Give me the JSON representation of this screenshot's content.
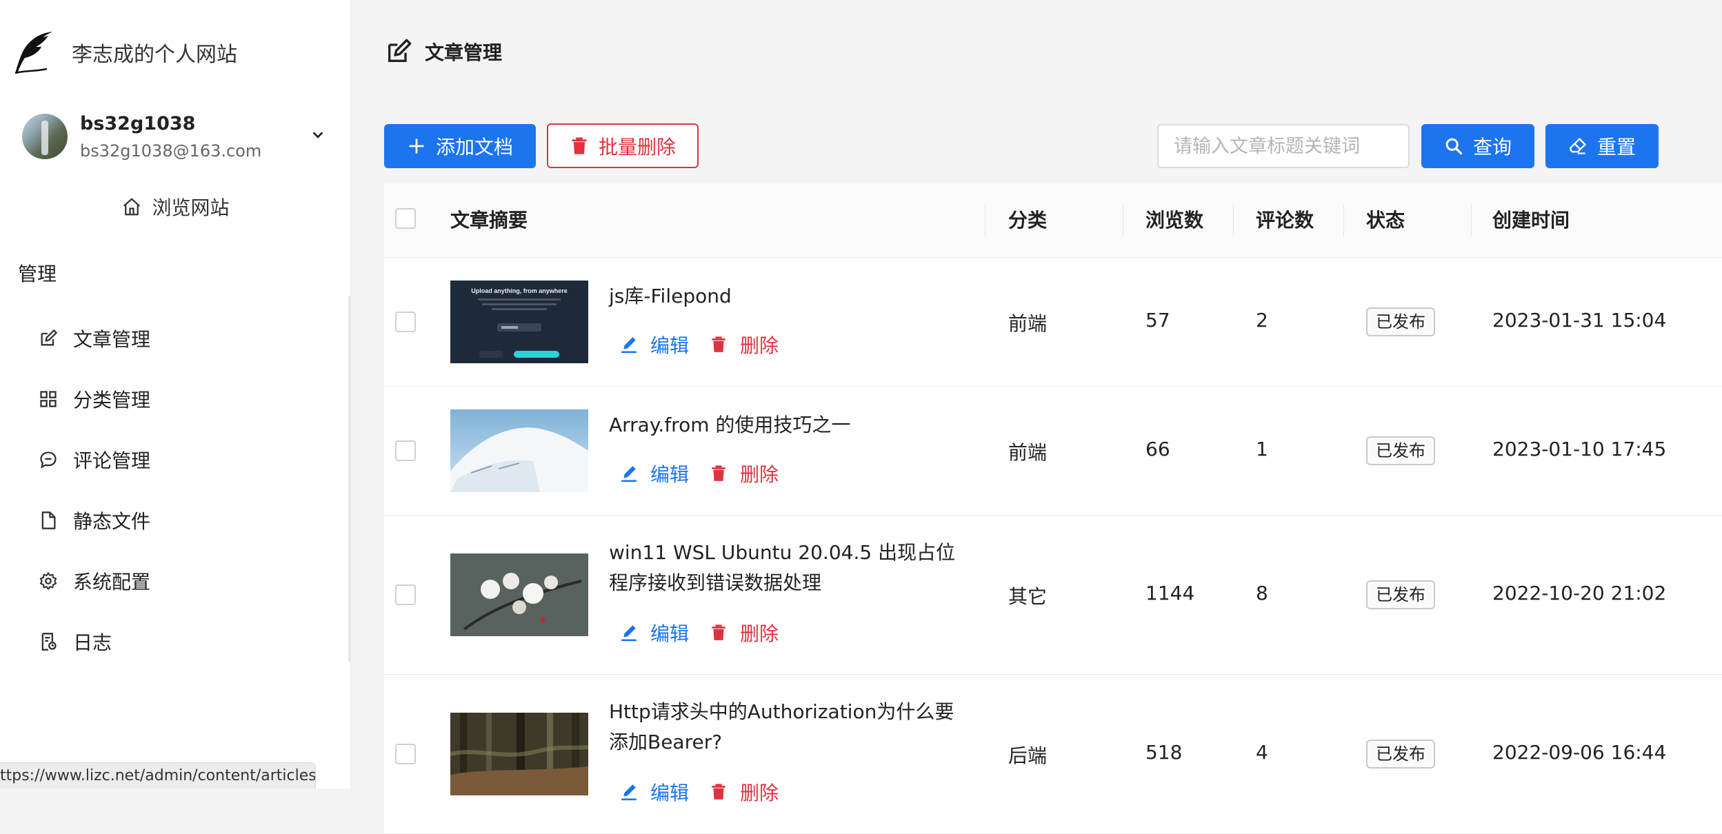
{
  "brand": {
    "title": "李志成的个人网站",
    "icon": "feather-icon"
  },
  "user": {
    "name": "bs32g1038",
    "email": "bs32g1038@163.com"
  },
  "sidebar": {
    "browse_label": "浏览网站",
    "section_label": "管理",
    "items": [
      {
        "label": "文章管理",
        "icon": "edit-icon"
      },
      {
        "label": "分类管理",
        "icon": "grid-icon"
      },
      {
        "label": "评论管理",
        "icon": "comments-icon"
      },
      {
        "label": "静态文件",
        "icon": "file-icon"
      },
      {
        "label": "系统配置",
        "icon": "gear-icon"
      },
      {
        "label": "日志",
        "icon": "log-icon"
      }
    ]
  },
  "page": {
    "title": "文章管理"
  },
  "toolbar": {
    "add_label": "添加文档",
    "batch_delete_label": "批量删除",
    "search_placeholder": "请输入文章标题关键词",
    "search_value": "",
    "query_label": "查询",
    "reset_label": "重置"
  },
  "table": {
    "headers": {
      "summary": "文章摘要",
      "category": "分类",
      "views": "浏览数",
      "comments": "评论数",
      "status": "状态",
      "created": "创建时间"
    },
    "edit_label": "编辑",
    "delete_label": "删除",
    "rows": [
      {
        "title": "js库-Filepond",
        "category": "前端",
        "views": "57",
        "comments": "2",
        "status": "已发布",
        "created": "2023-01-31 15:04",
        "thumb_text": "Upload anything, from anywhere"
      },
      {
        "title": "Array.from 的使用技巧之一",
        "category": "前端",
        "views": "66",
        "comments": "1",
        "status": "已发布",
        "created": "2023-01-10 17:45"
      },
      {
        "title": "win11 WSL Ubuntu 20.04.5 出现占位程序接收到错误数据处理",
        "category": "其它",
        "views": "1144",
        "comments": "8",
        "status": "已发布",
        "created": "2022-10-20 21:02"
      },
      {
        "title": "Http请求头中的Authorization为什么要添加Bearer?",
        "category": "后端",
        "views": "518",
        "comments": "4",
        "status": "已发布",
        "created": "2022-09-06 16:44"
      }
    ]
  },
  "status_bar": {
    "url": "ttps://www.lizc.net/admin/content/articles"
  },
  "colors": {
    "primary": "#1c74ef",
    "danger": "#e0323e",
    "background": "#f4f4f4"
  }
}
